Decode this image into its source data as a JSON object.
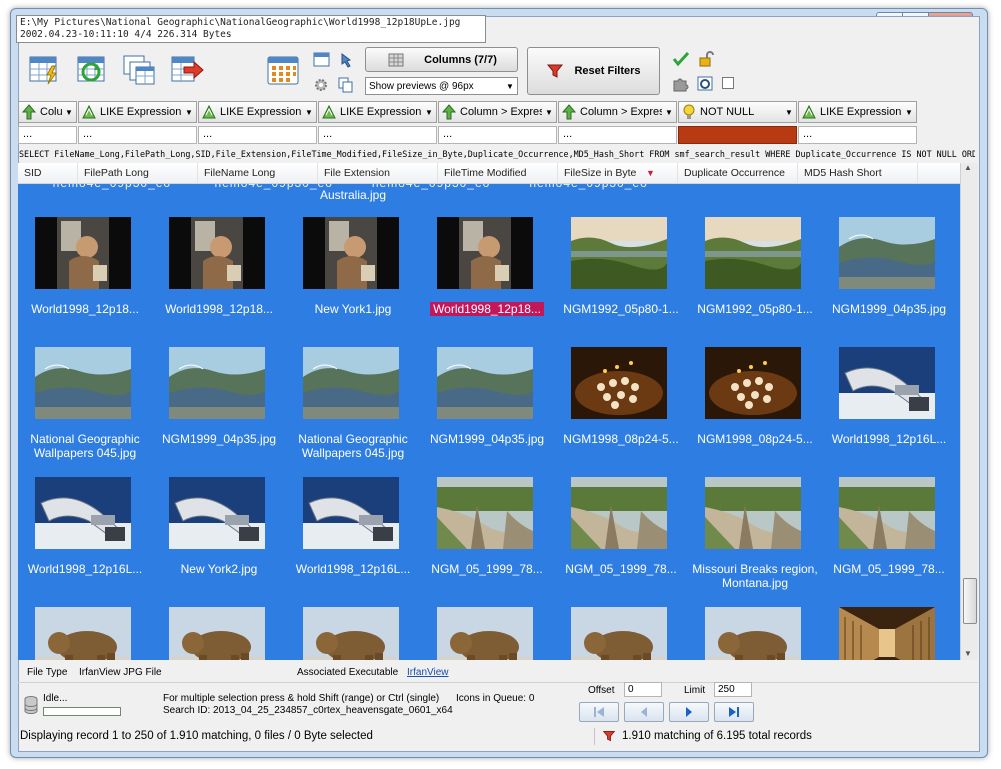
{
  "tooltip": {
    "path": "E:\\My Pictures\\National Geographic\\NationalGeographic\\World1998_12p18UpLe.jpg",
    "info": "2002.04.23-10:11:10      4/4      226.314 Bytes"
  },
  "toolbar": {
    "columns_label": "Columns (7/7)",
    "preview_value": "Show previews @ 96px",
    "reset_filters_label": "Reset Filters"
  },
  "filters": [
    {
      "label": "Colu",
      "icon": "arrow-up-icon"
    },
    {
      "label": "LIKE Expression",
      "icon": "like-expression-icon"
    },
    {
      "label": "LIKE Expression",
      "icon": "like-expression-icon"
    },
    {
      "label": "LIKE Expression",
      "icon": "like-expression-icon"
    },
    {
      "label": "Column > Expres",
      "icon": "arrow-up-icon"
    },
    {
      "label": "Column > Expres",
      "icon": "arrow-up-icon"
    },
    {
      "label": "NOT NULL",
      "icon": "lightbulb-icon"
    },
    {
      "label": "LIKE Expression",
      "icon": "like-expression-icon"
    }
  ],
  "filter_values": [
    "...",
    "...",
    "...",
    "...",
    "...",
    "...",
    "",
    "..."
  ],
  "sql": "SELECT FileName_Long,FilePath_Long,SID,File_Extension,FileTime_Modified,FileSize_in_Byte,Duplicate_Occurrence,MD5_Hash_Short FROM smf_search_result WHERE Duplicate_Occurrence IS NOT NULL ORDE",
  "columns": [
    "SID",
    "FilePath Long",
    "FileName Long",
    "File Extension",
    "FileTime Modified",
    "FileSize in Byte",
    "Duplicate Occurrence",
    "MD5 Hash Short"
  ],
  "partial_caption": "Australia.jpg",
  "thumbnails": [
    {
      "caption": "World1998_12p18...",
      "kind": "person-dark"
    },
    {
      "caption": "World1998_12p18...",
      "kind": "person-dark"
    },
    {
      "caption": "New York1.jpg",
      "kind": "person-dark"
    },
    {
      "caption": "World1998_12p18...",
      "kind": "person-dark",
      "selected": true
    },
    {
      "caption": "NGM1992_05p80-1...",
      "kind": "marsh"
    },
    {
      "caption": "NGM1992_05p80-1...",
      "kind": "marsh"
    },
    {
      "caption": "NGM1999_04p35.jpg",
      "kind": "coast"
    },
    {
      "caption": "National Geographic Wallpapers 045.jpg",
      "kind": "coast"
    },
    {
      "caption": "NGM1999_04p35.jpg",
      "kind": "coast"
    },
    {
      "caption": "National Geographic Wallpapers 045.jpg",
      "kind": "coast"
    },
    {
      "caption": "NGM1999_04p35.jpg",
      "kind": "coast"
    },
    {
      "caption": "NGM1998_08p24-5...",
      "kind": "candles"
    },
    {
      "caption": "NGM1998_08p24-5...",
      "kind": "candles"
    },
    {
      "caption": "World1998_12p16L...",
      "kind": "robot"
    },
    {
      "caption": "World1998_12p16L...",
      "kind": "robot"
    },
    {
      "caption": "New York2.jpg",
      "kind": "robot"
    },
    {
      "caption": "World1998_12p16L...",
      "kind": "robot"
    },
    {
      "caption": "NGM_05_1999_78...",
      "kind": "canyon"
    },
    {
      "caption": "NGM_05_1999_78...",
      "kind": "canyon"
    },
    {
      "caption": "Missouri Breaks region, Montana.jpg",
      "kind": "canyon"
    },
    {
      "caption": "NGM_05_1999_78...",
      "kind": "canyon"
    },
    {
      "caption": "",
      "kind": "bear"
    },
    {
      "caption": "",
      "kind": "bear"
    },
    {
      "caption": "",
      "kind": "bear"
    },
    {
      "caption": "",
      "kind": "bear"
    },
    {
      "caption": "",
      "kind": "bear"
    },
    {
      "caption": "",
      "kind": "bear"
    },
    {
      "caption": "",
      "kind": "corridor"
    }
  ],
  "details": {
    "file_type_label": "File Type",
    "file_type_value": "IrfanView JPG File",
    "assoc_label": "Associated Executable",
    "assoc_value": "IrfanView"
  },
  "progress": {
    "status": "Idle...",
    "fraction": 0.0
  },
  "hints": {
    "selection": "For multiple selection press & hold Shift (range) or Ctrl (single)",
    "search_id": "Search ID: 2013_04_25_234857_c0rtex_heavensgate_0601_x64",
    "queue": "Icons in Queue: 0"
  },
  "paging": {
    "offset_label": "Offset",
    "offset_value": "0",
    "limit_label": "Limit",
    "limit_value": "250"
  },
  "status": {
    "left": "Displaying record 1 to 250 of 1.910 matching, 0 files / 0 Byte selected",
    "right": "1.910 matching of 6.195 total records"
  },
  "colors": {
    "grid_bg": "#2e7de2",
    "selection": "#c2185b",
    "not_null_filter": "#b83a12"
  }
}
